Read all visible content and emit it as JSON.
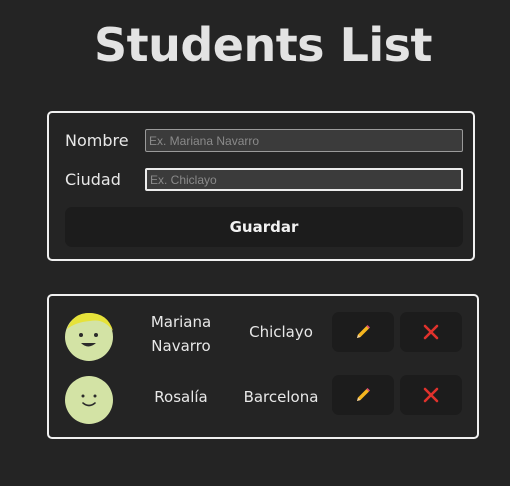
{
  "title": "Students List",
  "form": {
    "name_label": "Nombre",
    "name_placeholder": "Ex. Mariana Navarro",
    "name_value": "",
    "city_label": "Ciudad",
    "city_placeholder": "Ex. Chiclayo",
    "city_value": "",
    "save_label": "Guardar"
  },
  "students": [
    {
      "name": "Mariana Navarro",
      "city": "Chiclayo",
      "avatar": "smiling-face-with-hair-icon"
    },
    {
      "name": "Rosalía",
      "city": "Barcelona",
      "avatar": "smiling-face-icon"
    }
  ],
  "colors": {
    "background": "#242424",
    "card_border": "#f0f0f0",
    "button_bg": "#1c1c1c",
    "avatar_face": "#d3e3a5",
    "avatar_hair": "#e6e23a",
    "delete_icon": "#e0322c"
  },
  "icons": {
    "edit": "pencil-icon",
    "delete": "close-icon"
  }
}
